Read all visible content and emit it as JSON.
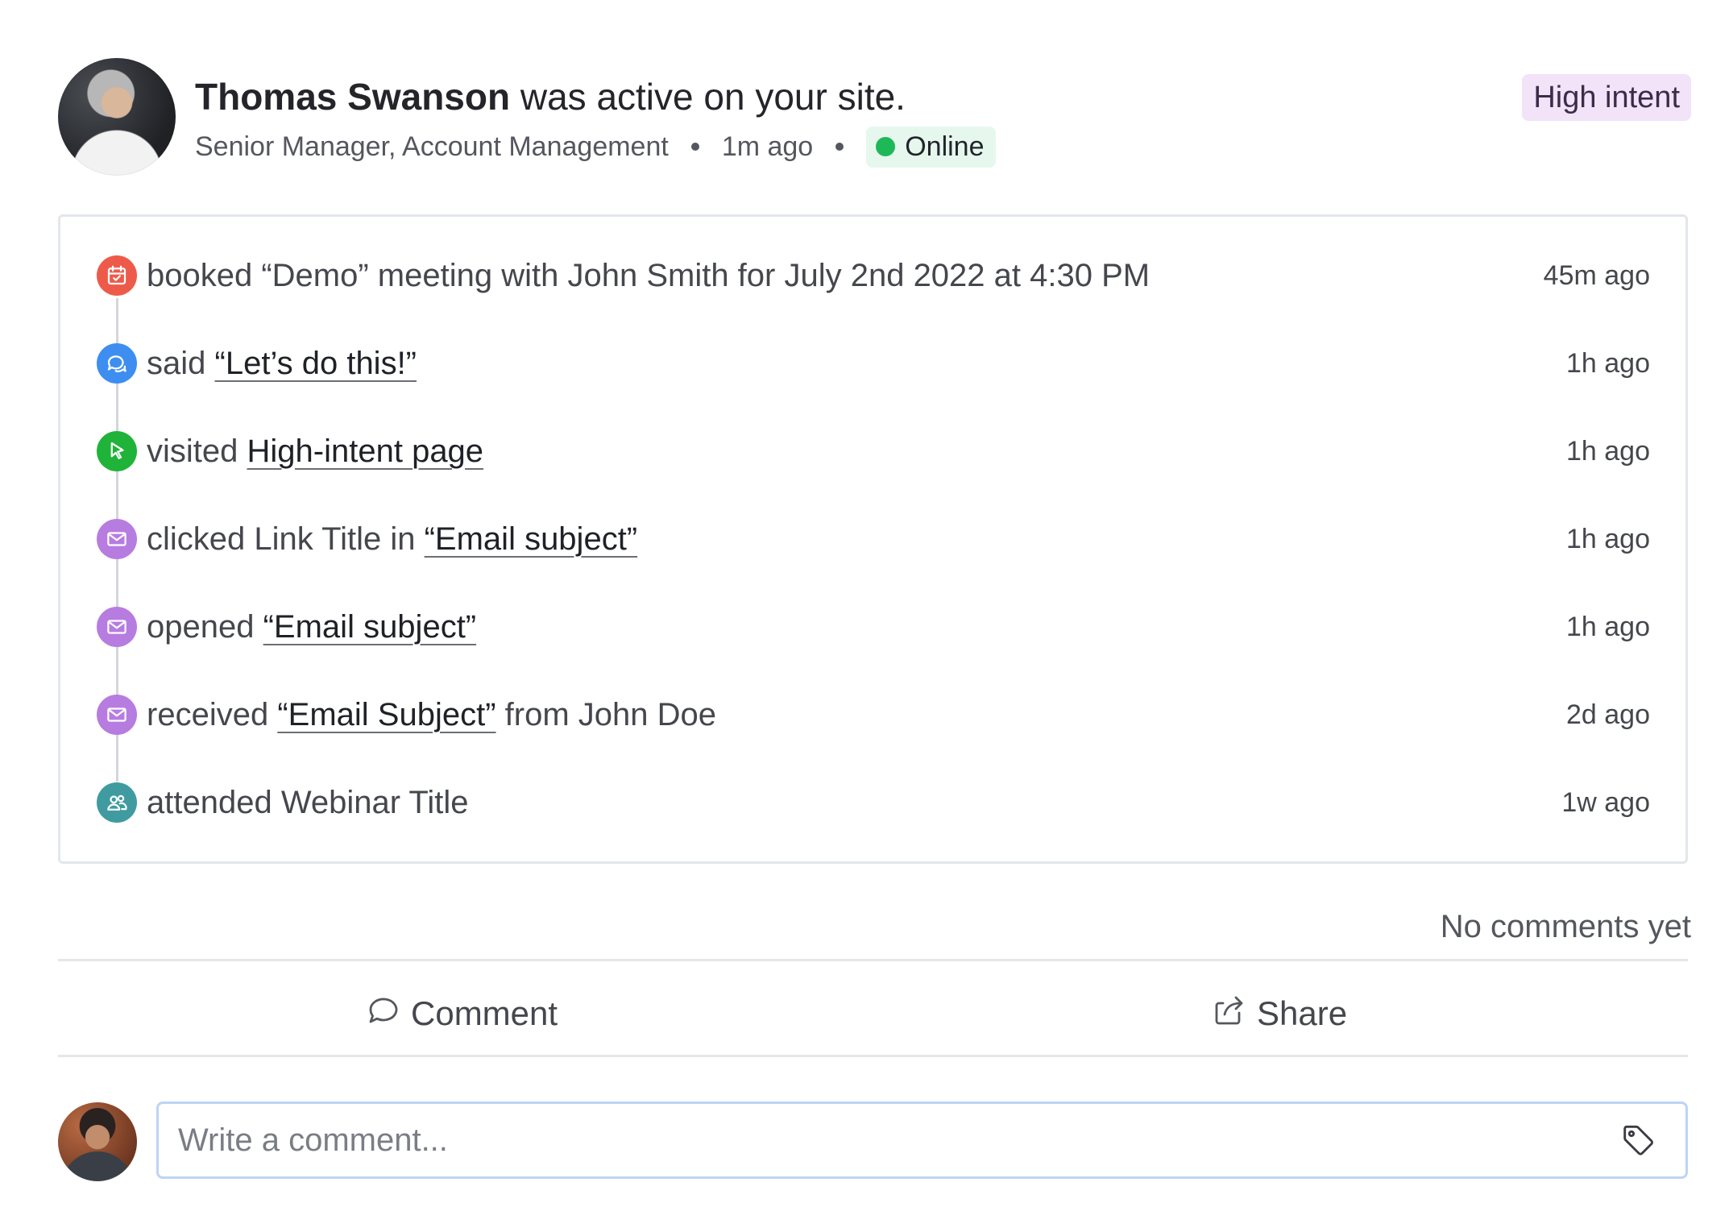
{
  "header": {
    "user_name": "Thomas Swanson",
    "activity_suffix": "was active on your site.",
    "job_title": "Senior Manager, Account Management",
    "last_seen": "1m ago",
    "status": "Online",
    "intent_badge": "High intent"
  },
  "activities": [
    {
      "icon": "calendar-icon",
      "color": "#ee5a4a",
      "verb": "booked “Demo” meeting with John Smith for July 2nd 2022 at 4:30 PM",
      "link": "",
      "suffix": "",
      "time": "45m ago"
    },
    {
      "icon": "chat-bubbles-icon",
      "color": "#3d8ef0",
      "verb": "said",
      "link": "“Let’s do this!”",
      "suffix": "",
      "time": "1h ago"
    },
    {
      "icon": "cursor-icon",
      "color": "#1fb33a",
      "verb": "visited",
      "link": "High-intent page",
      "suffix": "",
      "time": "1h ago"
    },
    {
      "icon": "envelope-icon",
      "color": "#b77ce0",
      "verb": "clicked Link Title in",
      "link": "“Email subject”",
      "suffix": "",
      "time": "1h ago"
    },
    {
      "icon": "envelope-icon",
      "color": "#b77ce0",
      "verb": "opened",
      "link": "“Email subject”",
      "suffix": "",
      "time": "1h ago"
    },
    {
      "icon": "envelope-icon",
      "color": "#b77ce0",
      "verb": "received",
      "link": "“Email Subject”",
      "suffix": "from John Doe",
      "time": "2d ago"
    },
    {
      "icon": "people-icon",
      "color": "#3f9ba0",
      "verb": "attended Webinar Title",
      "link": "",
      "suffix": "",
      "time": "1w ago"
    }
  ],
  "comments": {
    "count_text": "No comments yet",
    "comment_button": "Comment",
    "share_button": "Share",
    "input_placeholder": "Write a comment..."
  }
}
